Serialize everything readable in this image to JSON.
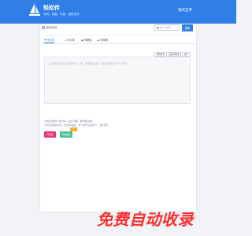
{
  "header": {
    "brand": "轻松传",
    "slogan": "手机、电脑、平板、轻松互传",
    "my_link": "我的互传"
  },
  "breadcrumb": {
    "label": "我的互传"
  },
  "search": {
    "placeholder": "输入提取码",
    "button": "提取"
  },
  "tabs": [
    {
      "label": "传文件",
      "icon": "file-icon"
    },
    {
      "label": "传文本",
      "icon": "text-icon"
    },
    {
      "label": "传图像",
      "icon": "image-icon"
    },
    {
      "label": "传视频",
      "icon": "video-icon"
    }
  ],
  "toolbar": {
    "select_file": "选择文件",
    "select_folder": "选择文件夹",
    "clear": "清空"
  },
  "editor": {
    "placeholder": "点击选择文件 或 拖文件（夹）拖放到此处（单次可添加10个文件）"
  },
  "notes": [
    "*非会员单文件上限1GB，会员无限制，费用限时免费",
    "*会员文件保存14天，会员永久保存，单个文件不超过20个，会员不限"
  ],
  "actions": {
    "upload": "开始传",
    "vip": "开通会员",
    "badge": "hot"
  },
  "watermark": "免费自动收录"
}
